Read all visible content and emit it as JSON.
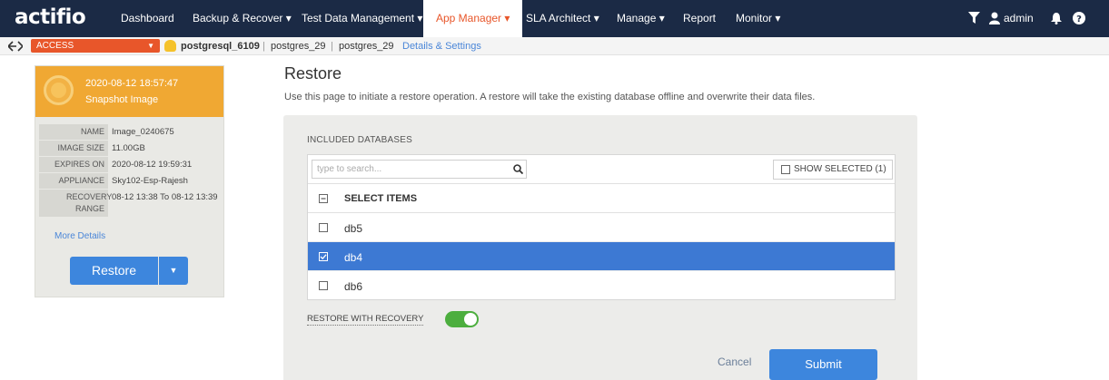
{
  "app": {
    "logo": "actifio"
  },
  "nav": {
    "items": [
      {
        "label": "Dashboard"
      },
      {
        "label": "Backup & Recover ▾"
      },
      {
        "label": "Test Data Management ▾"
      },
      {
        "label": "App Manager ▾",
        "active": true
      },
      {
        "label": "SLA Architect ▾"
      },
      {
        "label": "Manage ▾"
      },
      {
        "label": "Report"
      },
      {
        "label": "Monitor ▾"
      }
    ],
    "user": "admin",
    "colors": {
      "bar": "#1b2a45",
      "active_text": "#e8562a"
    }
  },
  "breadcrumb": {
    "access_value": "ACCESS",
    "app_name": "postgresql_6109",
    "host": "postgres_29",
    "instance": "postgres_29",
    "details_link": "Details & Settings"
  },
  "snapshot": {
    "datetime": "2020-08-12  18:57:47",
    "type": "Snapshot Image",
    "meta": [
      {
        "key": "NAME",
        "value": "Image_0240675"
      },
      {
        "key": "IMAGE SIZE",
        "value": "11.00GB"
      },
      {
        "key": "EXPIRES ON",
        "value": "2020-08-12 19:59:31"
      },
      {
        "key": "APPLIANCE",
        "value": "Sky102-Esp-Rajesh"
      },
      {
        "key": "RECOVERY RANGE",
        "value": "08-12 13:38 To 08-12 13:39"
      }
    ],
    "more_details": "More Details",
    "restore_button": "Restore",
    "accent": "#f0a833"
  },
  "main": {
    "title": "Restore",
    "description": "Use this page to initiate a restore operation. A restore will take the existing database offline and overwrite their data files.",
    "included_label": "INCLUDED DATABASES",
    "search_placeholder": "type to search...",
    "show_selected": "SHOW SELECTED (1)",
    "select_items": "SELECT ITEMS",
    "databases": [
      {
        "name": "db5",
        "selected": false
      },
      {
        "name": "db4",
        "selected": true
      },
      {
        "name": "db6",
        "selected": false
      }
    ],
    "restore_with_recovery_label": "RESTORE WITH RECOVERY",
    "restore_with_recovery": true,
    "cancel": "Cancel",
    "submit": "Submit",
    "colors": {
      "primary": "#3d86dd",
      "selected_row": "#3d79d3",
      "toggle_on": "#4cae3e"
    }
  }
}
